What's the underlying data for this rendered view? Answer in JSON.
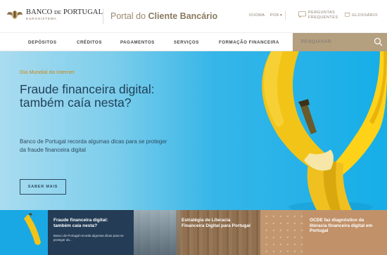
{
  "header": {
    "logo_name": "BANCO",
    "logo_name_de": "DE",
    "logo_name_rest": "PORTUGAL",
    "logo_sub": "EUROSISTEMA",
    "portal_prefix": "Portal do",
    "portal_bold": "Cliente Bancário",
    "language_label": "IDIOMA",
    "language_value": "PORTUGUÊS",
    "faq_line1": "PERGUNTAS",
    "faq_line2": "FREQUENTES",
    "glossary_label": "GLOSSÁRIO"
  },
  "nav": {
    "items": [
      "DEPÓSITOS",
      "CRÉDITOS",
      "PAGAMENTOS",
      "SERVIÇOS",
      "FORMAÇÃO FINANCEIRA"
    ],
    "search_placeholder": "PESQUISAR"
  },
  "hero": {
    "pretitle": "Dia Mundial da Internet",
    "title": "Fraude financeira digital: também caía nesta?",
    "text": "Banco de Portugal recorda algumas dicas para se proteger da fraude financeira digital",
    "button": "SABER MAIS"
  },
  "cards": [
    {
      "title": "Fraude financeira digital: também caía nesta?",
      "desc": "Banco de Portugal recorda algumas dicas para se proteger do..."
    },
    {
      "title": "Estratégia de Literacia Financeira Digital para Portugal"
    },
    {
      "title": "OCDE faz diagnóstico da literacia financeira digital em Portugal"
    }
  ],
  "colors": {
    "accent": "#b49f7f",
    "hero_blue": "#16aee8",
    "title_navy": "#1f3f57",
    "card_navy": "#243c55"
  }
}
